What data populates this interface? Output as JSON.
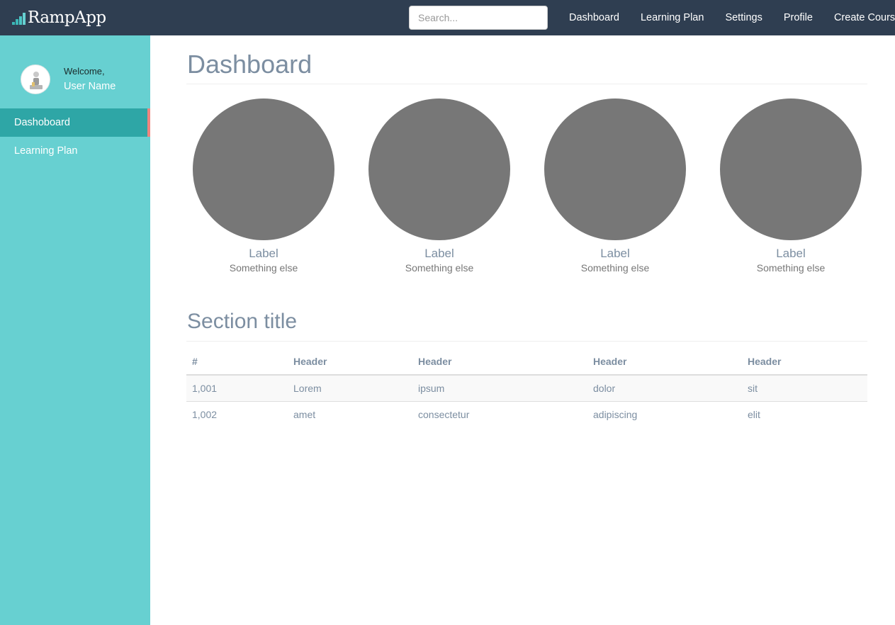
{
  "app": {
    "brand": "RampApp"
  },
  "search": {
    "placeholder": "Search..."
  },
  "nav": {
    "items": [
      "Dashboard",
      "Learning Plan",
      "Settings",
      "Profile",
      "Create Course"
    ]
  },
  "sidebar": {
    "welcome": "Welcome,",
    "user_name": "User Name",
    "items": [
      {
        "label": "Dashoboard",
        "active": true
      },
      {
        "label": "Learning Plan",
        "active": false
      }
    ]
  },
  "main": {
    "title": "Dashboard",
    "stats": [
      {
        "label": "Label",
        "sub": "Something else"
      },
      {
        "label": "Label",
        "sub": "Something else"
      },
      {
        "label": "Label",
        "sub": "Something else"
      },
      {
        "label": "Label",
        "sub": "Something else"
      }
    ],
    "section_title": "Section title",
    "table": {
      "headers": [
        "#",
        "Header",
        "Header",
        "Header",
        "Header"
      ],
      "rows": [
        [
          "1,001",
          "Lorem",
          "ipsum",
          "dolor",
          "sit"
        ],
        [
          "1,002",
          "amet",
          "consectetur",
          "adipiscing",
          "elit"
        ]
      ]
    }
  },
  "colors": {
    "topbar": "#2f3e51",
    "sidebar": "#67d0d1",
    "sidebar_active": "#2ea6a6",
    "active_indicator": "#f0857f",
    "heading": "#7c8ea1",
    "placeholder_circle": "#777777"
  },
  "icons": {
    "logo": "stairs-logo-icon",
    "avatar": "user-avatar-icon"
  }
}
